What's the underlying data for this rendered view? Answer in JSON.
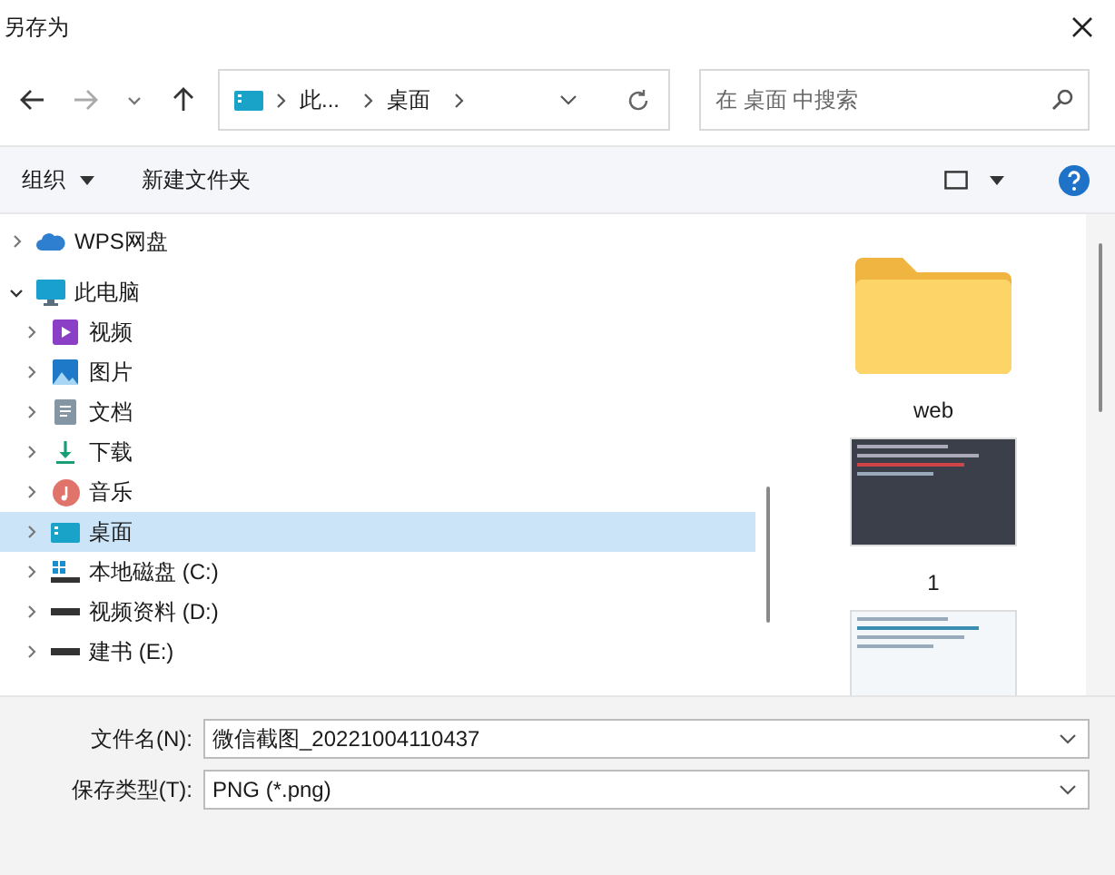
{
  "window": {
    "title": "另存为"
  },
  "address": {
    "crumbs": [
      "此...",
      "桌面"
    ]
  },
  "search": {
    "placeholder": "在 桌面 中搜索"
  },
  "toolbar": {
    "organize": "组织",
    "new_folder": "新建文件夹"
  },
  "tree": [
    {
      "label": "WPS网盘",
      "expanded": false,
      "selected": false
    },
    {
      "label": "此电脑",
      "expanded": true,
      "selected": false,
      "children": [
        {
          "label": "视频",
          "expanded": false,
          "selected": false
        },
        {
          "label": "图片",
          "expanded": false,
          "selected": false
        },
        {
          "label": "文档",
          "expanded": false,
          "selected": false
        },
        {
          "label": "下载",
          "expanded": false,
          "selected": false
        },
        {
          "label": "音乐",
          "expanded": false,
          "selected": false
        },
        {
          "label": "桌面",
          "expanded": false,
          "selected": true
        },
        {
          "label": "本地磁盘 (C:)",
          "expanded": false,
          "selected": false
        },
        {
          "label": "视频资料 (D:)",
          "expanded": false,
          "selected": false
        },
        {
          "label": "建书 (E:)",
          "expanded": false,
          "selected": false
        }
      ]
    }
  ],
  "files": [
    {
      "kind": "folder",
      "name": "web"
    },
    {
      "kind": "image",
      "name": "1"
    },
    {
      "kind": "image"
    }
  ],
  "fields": [
    {
      "label": "文件名(N):",
      "value": "微信截图_20221004110437"
    },
    {
      "label": "保存类型(T):",
      "value": "PNG (*.png)"
    }
  ]
}
